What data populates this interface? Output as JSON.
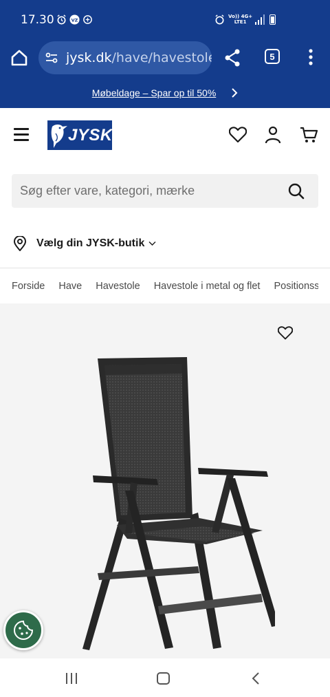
{
  "status_bar": {
    "time": "17.30",
    "network_line1": "Vo)) 4G+",
    "network_line2": "LTE1"
  },
  "browser": {
    "url_domain": "jysk.dk",
    "url_path": "/have/havestole/",
    "tab_count": "5"
  },
  "promo": {
    "text": "Møbeldage – Spar op til 50%"
  },
  "header": {
    "logo_text": "JYSK"
  },
  "search": {
    "placeholder": "Søg efter vare, kategori, mærke"
  },
  "store": {
    "label": "Vælg din JYSK-butik"
  },
  "breadcrumb": {
    "items": [
      "Forside",
      "Have",
      "Havestole",
      "Havestole i metal og flet",
      "Positionsstole"
    ]
  },
  "colors": {
    "brand_blue": "#143c8c",
    "cookie_green": "#2e6b4a"
  },
  "icons": {
    "home": "home-icon",
    "share": "share-icon",
    "menu": "more-vert-icon",
    "wishlist": "heart-icon",
    "account": "user-icon",
    "cart": "cart-icon",
    "search": "search-icon",
    "store": "location-pin-icon",
    "cookie": "cookie-icon"
  }
}
